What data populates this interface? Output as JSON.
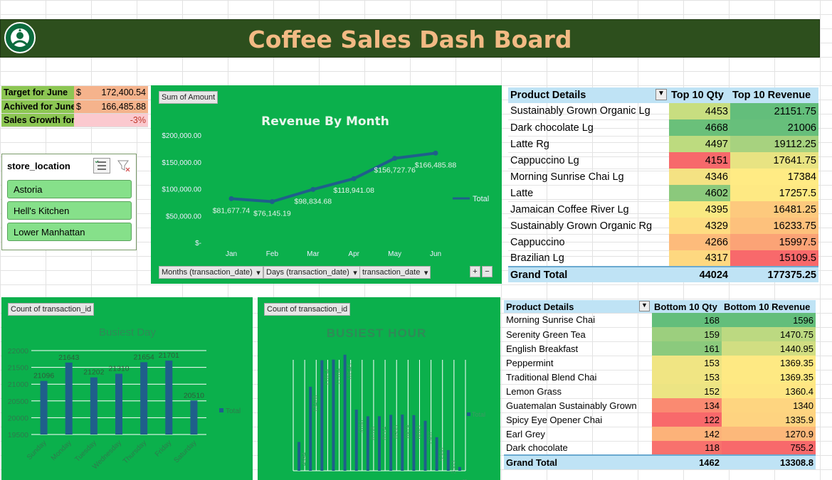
{
  "banner": {
    "title": "Coffee Sales Dash Board",
    "logo_icon": "starbucks-logo-icon"
  },
  "kpi": {
    "target_label": "Target for June",
    "target_cur": "$",
    "target_val": "172,400.54",
    "achieved_label": "Achived for June",
    "achieved_cur": "$",
    "achieved_val": "166,485.88",
    "growth_label": "Sales Growth for June",
    "growth_val": "-3%"
  },
  "slicer": {
    "title": "store_location",
    "items": [
      "Astoria",
      "Hell's Kitchen",
      "Lower Manhattan"
    ]
  },
  "revenue_chart": {
    "tag": "Sum of Amount",
    "filters": [
      "Months (transaction_date)",
      "Days (transaction_date)",
      "transaction_date"
    ]
  },
  "day_chart": {
    "tag": "Count of transaction_id"
  },
  "hour_chart": {
    "tag": "Count of transaction_id"
  },
  "top_table": {
    "headers": [
      "Product Details",
      "Top 10 Qty",
      "Top 10 Revenue"
    ],
    "rows": [
      [
        "Sustainably Grown Organic Lg",
        "4453",
        "21151.75"
      ],
      [
        "Dark chocolate Lg",
        "4668",
        "21006"
      ],
      [
        "Latte Rg",
        "4497",
        "19112.25"
      ],
      [
        "Cappuccino Lg",
        "4151",
        "17641.75"
      ],
      [
        "Morning Sunrise Chai Lg",
        "4346",
        "17384"
      ],
      [
        "Latte",
        "4602",
        "17257.5"
      ],
      [
        "Jamaican Coffee River Lg",
        "4395",
        "16481.25"
      ],
      [
        "Sustainably Grown Organic Rg",
        "4329",
        "16233.75"
      ],
      [
        "Cappuccino",
        "4266",
        "15997.5"
      ],
      [
        "Brazilian Lg",
        "4317",
        "15109.5"
      ]
    ],
    "total": [
      "Grand Total",
      "44024",
      "177375.25"
    ],
    "qty_colors": [
      "#c8de80",
      "#6ac07a",
      "#bddb7f",
      "#f7696b",
      "#f4e283",
      "#8bc97c",
      "#f9e982",
      "#fedd81",
      "#fdbb7b",
      "#fed880"
    ],
    "rev_colors": [
      "#63be7b",
      "#67bf7b",
      "#a7d27f",
      "#e8e382",
      "#ffeb84",
      "#fee983",
      "#fdc97d",
      "#fdc17c",
      "#fba376",
      "#f8696b"
    ]
  },
  "bottom_table": {
    "headers": [
      "Product Details",
      "Bottom 10 Qty",
      "Bottom 10 Revenue"
    ],
    "rows": [
      [
        "Morning Sunrise Chai",
        "168",
        "1596"
      ],
      [
        "Serenity Green Tea",
        "159",
        "1470.75"
      ],
      [
        "English Breakfast",
        "161",
        "1440.95"
      ],
      [
        "Peppermint",
        "153",
        "1369.35"
      ],
      [
        "Traditional Blend Chai",
        "153",
        "1369.35"
      ],
      [
        "Lemon Grass",
        "152",
        "1360.4"
      ],
      [
        "Guatemalan Sustainably Grown",
        "134",
        "1340"
      ],
      [
        "Spicy Eye Opener Chai",
        "122",
        "1335.9"
      ],
      [
        "Earl Grey",
        "142",
        "1270.9"
      ],
      [
        "Dark chocolate",
        "118",
        "755.2"
      ]
    ],
    "total": [
      "Grand Total",
      "1462",
      "13308.8"
    ],
    "qty_colors": [
      "#63be7b",
      "#9ccf7e",
      "#8bca7d",
      "#f0e583",
      "#f0e583",
      "#ece483",
      "#fa8a71",
      "#f8696b",
      "#fcb279",
      "#f8716d"
    ],
    "rev_colors": [
      "#63be7b",
      "#bcd981",
      "#d1de82",
      "#fee983",
      "#fee983",
      "#fee683",
      "#fed580",
      "#fed380",
      "#fcb87a",
      "#f8696b"
    ]
  },
  "chart_data": [
    {
      "type": "line",
      "title": "Revenue By Month",
      "categories": [
        "Jan",
        "Feb",
        "Mar",
        "Apr",
        "May",
        "Jun"
      ],
      "series": [
        {
          "name": "Total",
          "values": [
            81677.74,
            76145.19,
            98834.68,
            118941.08,
            156727.76,
            166485.88
          ]
        }
      ],
      "data_labels": [
        "$81,677.74",
        "$76,145.19",
        "$98,834.68",
        "$118,941.08",
        "$156,727.76",
        "$166,485.88"
      ],
      "y_ticks": [
        "$200,000.00",
        "$150,000.00",
        "$100,000.00",
        "$50,000.00",
        "$-"
      ],
      "ylim": [
        0,
        200000
      ],
      "color": "#1f5f8b"
    },
    {
      "type": "bar",
      "title": "Busiest Day",
      "categories": [
        "Sunday",
        "Monday",
        "Tuesday",
        "Wednesday",
        "Thursday",
        "Friday",
        "Saturday"
      ],
      "series": [
        {
          "name": "Total",
          "values": [
            21096,
            21643,
            21202,
            21310,
            21654,
            21701,
            20510
          ]
        }
      ],
      "y_ticks": [
        "22000",
        "21500",
        "21000",
        "20500",
        "20000",
        "19500"
      ],
      "ylim": [
        19500,
        22000
      ],
      "color": "#1f5f8b"
    },
    {
      "type": "bar",
      "title": "BUSIEST HOUR",
      "series": [
        {
          "name": "Total",
          "values": [
            4594,
            13428,
            17654,
            17764,
            18545,
            9766,
            8708,
            8714,
            8933,
            8979,
            8893,
            7987,
            5360,
            3303,
            603
          ]
        }
      ],
      "bar_labels": [
        "4594",
        "13428",
        "17654",
        "17764",
        "18545",
        "9766",
        "8708",
        "8714",
        "8933",
        "8979",
        "8893",
        "7987",
        "5360",
        "3303",
        "603"
      ],
      "color": "#1f5f8b"
    }
  ]
}
